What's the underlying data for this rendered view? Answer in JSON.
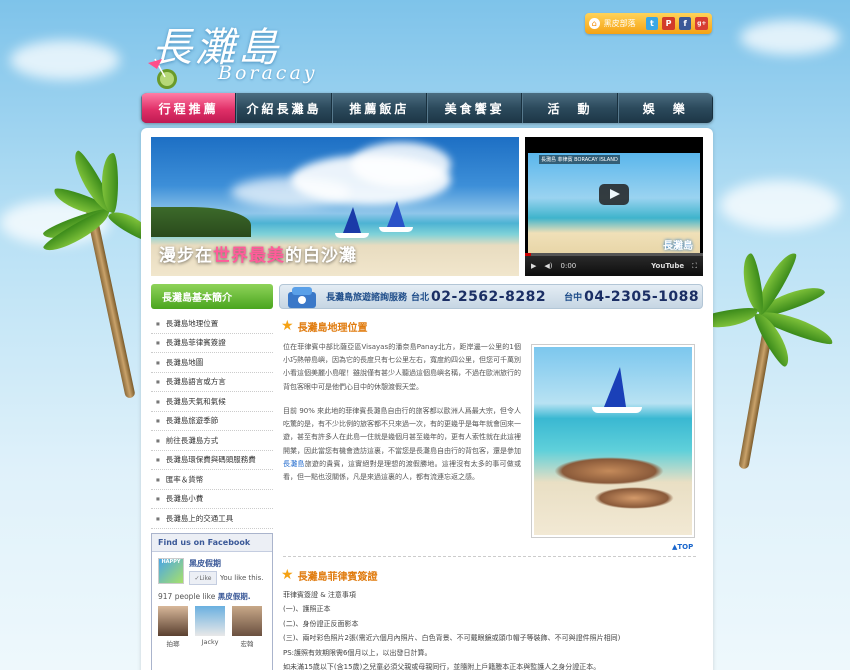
{
  "header": {
    "logo_cn": "長灘島",
    "logo_en": "Boracay",
    "social_label": "黑皮部落",
    "social_buttons": [
      {
        "icon": "twitter-icon",
        "glyph": "t",
        "color": "#3aa7e6"
      },
      {
        "icon": "plurk-icon",
        "glyph": "P",
        "color": "#d23c2a"
      },
      {
        "icon": "facebook-icon",
        "glyph": "f",
        "color": "#3b5998"
      },
      {
        "icon": "google-plus-icon",
        "glyph": "g+",
        "color": "#d73d32"
      }
    ]
  },
  "nav": [
    {
      "label": "行程推薦",
      "active": true
    },
    {
      "label": "介紹長灘島",
      "active": false
    },
    {
      "label": "推薦飯店",
      "active": false
    },
    {
      "label": "美食饗宴",
      "active": false
    },
    {
      "label": "活　動",
      "active": false
    },
    {
      "label": "娛　樂",
      "active": false
    }
  ],
  "hero": {
    "caption_a": "漫步在",
    "caption_b": "世界最美",
    "caption_c": "的白沙灘"
  },
  "video": {
    "title": "長灘島 菲律賓 BORACAY ISLAND",
    "time": "0:00",
    "brand": "YouTube",
    "overlay_logo": "長灘島"
  },
  "sidebar": {
    "title": "長灘島基本簡介",
    "items": [
      "長灘島地理位置",
      "長灘島菲律賓簽證",
      "長灘島地圖",
      "長灘島語言或方言",
      "長灘島天氣和氣候",
      "長灘島旅遊季節",
      "前往長灘島方式",
      "長灘島環保費與碼頭服務費",
      "匯率＆貨幣",
      "長灘島小費",
      "長灘島上的交通工具"
    ]
  },
  "facebook": {
    "heading": "Find us on Facebook",
    "page_name": "黑皮假期",
    "like_button": "Like",
    "like_text": "You like this.",
    "count_text": "917 people like",
    "count_page": "黑皮假期.",
    "faces": [
      "拍瑯",
      "Jacky",
      "宏翰",
      "",
      "",
      ""
    ]
  },
  "contact": {
    "service": "長灘島旅遊諮詢服務",
    "city1": "台北",
    "phone1": "02-2562-8282",
    "city2": "台中",
    "phone2": "04-2305-1088"
  },
  "section1": {
    "title": "長灘島地理位置",
    "para1": "位在菲律賓中部比薩亞區Visayas的潘奈島Panay北方，距岸邊一公里的1個小巧熱帶島嶼，因為它的長度只有七公里左右，寬度約四公里，但您可千萬別小看這個美麗小島喔！雖說僅有甚少人聽過這個島嶼名稱，不過在歐洲旅行的背包客眼中可是他們心目中的休憩渡假天堂。",
    "para2a": "目前 90% 來此地的菲律賓長灘島自由行的旅客都以歐洲人爲最大宗，但令人吃驚的是，有不少比例的旅客都不只來過一次，有的更幾乎是每年就會回來一遊，甚至有許多人在此島一住就是幾個月甚至幾年的，更有人索性就在此這裡開業，因此當您有機會造訪這裏，不當您是長灘島自由行的背包客，還是參加",
    "para2_link": "長灘島",
    "para2b": "旅遊的貴賓，這實絕對是理想的渡假勝地。這裡沒有太多的事可做或看，但一點也沒關係，凡是來過這裏的人，都有流連忘返之感。",
    "top_link": "▲TOP"
  },
  "section2": {
    "title": "長灘島菲律賓簽證",
    "lines": [
      "菲律賓簽證 & 注意事項",
      "(一)、護照正本",
      "(二)、身份證正反面影本",
      "(三)、兩吋彩色照片2張(需近六個月內照片、白色背景、不可戴眼鏡或頭巾帽子等裝飾、不可與證件照片相同)",
      "PS:護照有效期限需6個月以上，以出發日計算。",
      "如未滿15歲以下(含15歲)之兒童必須父親或母親同行，並隨附上戶籍謄本正本與監護人之身分證正本。"
    ]
  }
}
